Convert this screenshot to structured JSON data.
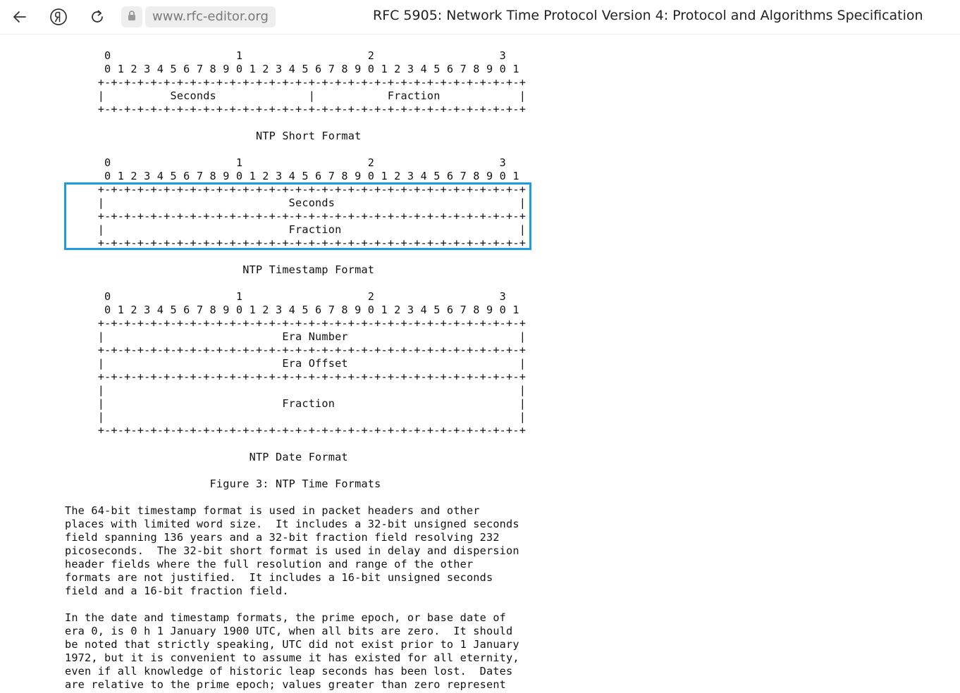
{
  "browser": {
    "url": "www.rfc-editor.org",
    "tab_title": "RFC 5905: Network Time Protocol Version 4: Protocol and Algorithms Specification",
    "back_icon": "arrow-left-icon",
    "yandex_icon": "yandex-logo-icon",
    "reload_icon": "reload-icon",
    "lock_icon": "lock-icon"
  },
  "highlight": {
    "color": "#1a9ee0"
  },
  "document": {
    "lines": [
      "      0                   1                   2                   3",
      "      0 1 2 3 4 5 6 7 8 9 0 1 2 3 4 5 6 7 8 9 0 1 2 3 4 5 6 7 8 9 0 1",
      "     +-+-+-+-+-+-+-+-+-+-+-+-+-+-+-+-+-+-+-+-+-+-+-+-+-+-+-+-+-+-+-+-+",
      "     |          Seconds              |           Fraction            |",
      "     +-+-+-+-+-+-+-+-+-+-+-+-+-+-+-+-+-+-+-+-+-+-+-+-+-+-+-+-+-+-+-+-+",
      "",
      "                             NTP Short Format",
      "",
      "      0                   1                   2                   3",
      "      0 1 2 3 4 5 6 7 8 9 0 1 2 3 4 5 6 7 8 9 0 1 2 3 4 5 6 7 8 9 0 1",
      "     +-+-+-+-+-+-+-+-+-+-+-+-+-+-+-+-+-+-+-+-+-+-+-+-+-+-+-+-+-+-+-+-+",
      "     |                            Seconds                            |",
      "     +-+-+-+-+-+-+-+-+-+-+-+-+-+-+-+-+-+-+-+-+-+-+-+-+-+-+-+-+-+-+-+-+",
      "     |                            Fraction                           |",
      "     +-+-+-+-+-+-+-+-+-+-+-+-+-+-+-+-+-+-+-+-+-+-+-+-+-+-+-+-+-+-+-+-+",
      "",
      "                           NTP Timestamp Format",
      "",
      "      0                   1                   2                   3",
      "      0 1 2 3 4 5 6 7 8 9 0 1 2 3 4 5 6 7 8 9 0 1 2 3 4 5 6 7 8 9 0 1",
      "     +-+-+-+-+-+-+-+-+-+-+-+-+-+-+-+-+-+-+-+-+-+-+-+-+-+-+-+-+-+-+-+-+",
      "     |                           Era Number                          |",
      "     +-+-+-+-+-+-+-+-+-+-+-+-+-+-+-+-+-+-+-+-+-+-+-+-+-+-+-+-+-+-+-+-+",
      "     |                           Era Offset                          |",
      "     +-+-+-+-+-+-+-+-+-+-+-+-+-+-+-+-+-+-+-+-+-+-+-+-+-+-+-+-+-+-+-+-+",
      "     |                                                               |",
      "     |                           Fraction                            |",
      "     |                                                               |",
      "     +-+-+-+-+-+-+-+-+-+-+-+-+-+-+-+-+-+-+-+-+-+-+-+-+-+-+-+-+-+-+-+-+",
      "",
      "                            NTP Date Format",
      "",
      "                      Figure 3: NTP Time Formats",
      "",
      "The 64-bit timestamp format is used in packet headers and other",
      "places with limited word size.  It includes a 32-bit unsigned seconds",
      "field spanning 136 years and a 32-bit fraction field resolving 232",
      "picoseconds.  The 32-bit short format is used in delay and dispersion",
      "header fields where the full resolution and range of the other",
      "formats are not justified.  It includes a 16-bit unsigned seconds",
      "field and a 16-bit fraction field.",
      "",
      "In the date and timestamp formats, the prime epoch, or base date of",
      "era 0, is 0 h 1 January 1900 UTC, when all bits are zero.  It should",
      "be noted that strictly speaking, UTC did not exist prior to 1 January",
      "1972, but it is convenient to assume it has existed for all eternity,",
      "even if all knowledge of historic leap seconds has been lost.  Dates",
      "are relative to the prime epoch; values greater than zero represent"
    ]
  }
}
